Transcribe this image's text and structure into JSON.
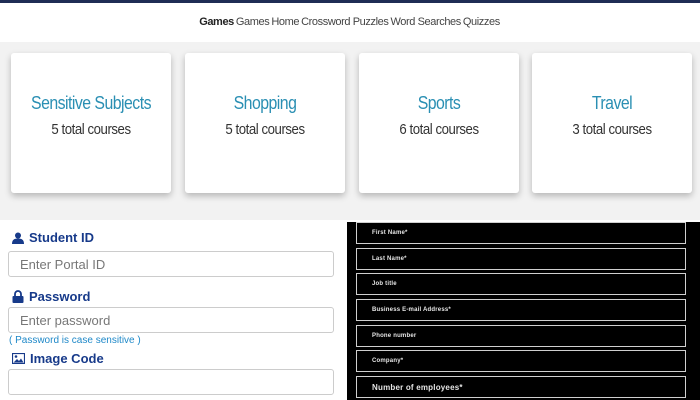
{
  "nav": {
    "brand": "Games",
    "links": [
      "Games",
      "Home",
      "Crossword Puzzles",
      "Word Searches",
      "Quizzes"
    ]
  },
  "courses": [
    {
      "title": "Sensitive Subjects",
      "count": "5 total courses"
    },
    {
      "title": "Shopping",
      "count": "5 total courses"
    },
    {
      "title": "Sports",
      "count": "6 total courses"
    },
    {
      "title": "Travel",
      "count": "3 total courses"
    }
  ],
  "login": {
    "student_id_label": "Student ID",
    "student_id_placeholder": "Enter Portal ID",
    "password_label": "Password",
    "password_placeholder": "Enter password",
    "password_hint": "( Password is case sensitive )",
    "image_code_label": "Image Code",
    "image_code_placeholder": ""
  },
  "contact_form": {
    "fields": [
      "First Name*",
      "Last Name*",
      "Job title",
      "Business E-mail Address*",
      "Phone number",
      "Company*",
      "Number of employees*"
    ]
  },
  "colors": {
    "accent_blue": "#2a8fb3",
    "label_navy": "#173a8a",
    "hint_blue": "#1e88c8",
    "form_bg": "#000000"
  }
}
